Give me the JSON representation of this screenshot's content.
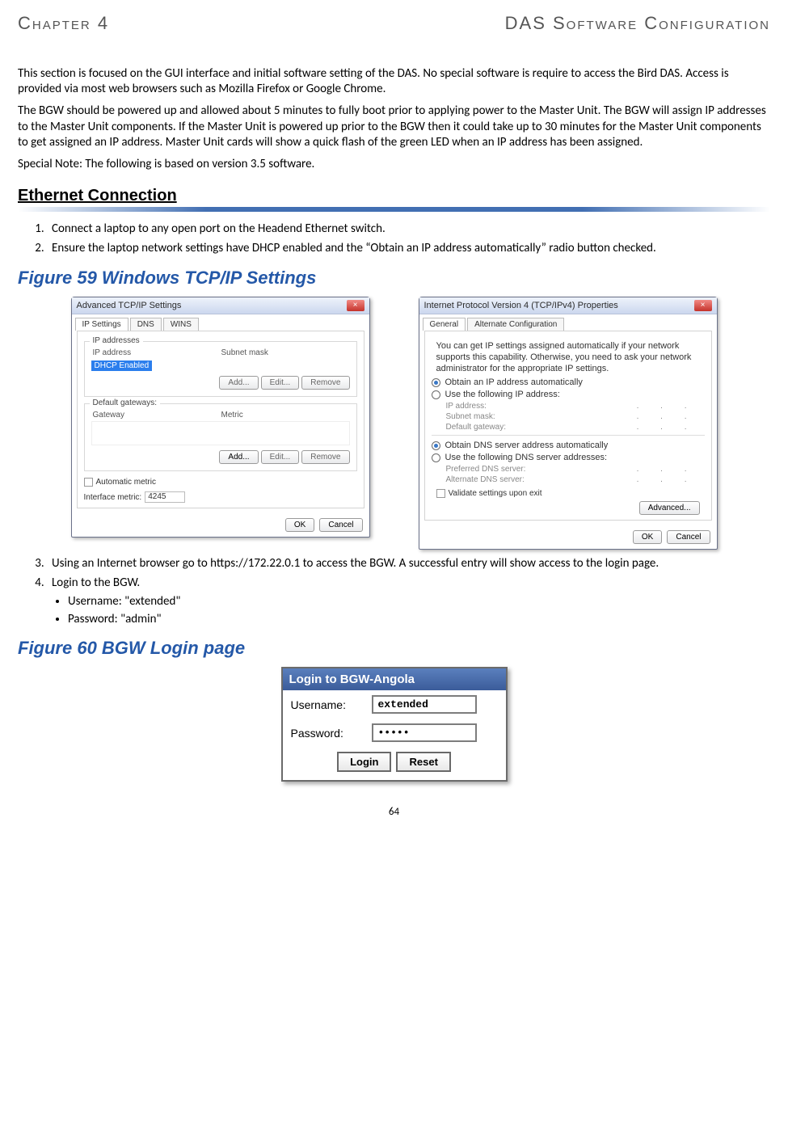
{
  "header": {
    "chapter": "Chapter 4",
    "title": "DAS Software Configuration"
  },
  "paras": {
    "p1": "This section is focused on the GUI interface and initial software setting of the DAS. No special software is require to access the Bird DAS. Access is provided via most web browsers such as Mozilla Firefox or Google Chrome.",
    "p2": "The BGW should be powered up and allowed about 5 minutes to fully boot prior to applying power to the Master Unit. The BGW will assign IP addresses to the Master Unit components. If the Master Unit is powered up prior to the BGW then it could take up to 30 minutes for the Master Unit components to get assigned an IP address. Master Unit cards will show a quick flash of the green LED when an IP address has been assigned.",
    "p3": "Special Note: The following is based on version 3.5 software."
  },
  "sections": {
    "ethernet": "Ethernet Connection"
  },
  "steps": {
    "s1": "Connect a laptop to any open port on the Headend Ethernet switch.",
    "s2": "Ensure the laptop network settings have DHCP enabled and the “Obtain an IP address automatically” radio button checked.",
    "s3": "Using an Internet browser go to https://172.22.0.1 to access the BGW. A successful entry will show access to the login page.",
    "s4": "Login to the BGW.",
    "b1": "Username: \"extended\"",
    "b2": "Password: \"admin\""
  },
  "figs": {
    "f59": "Figure 59    Windows TCP/IP Settings",
    "f60": "Figure 60    BGW Login page"
  },
  "dlg1": {
    "title": "Advanced TCP/IP Settings",
    "tabs": [
      "IP Settings",
      "DNS",
      "WINS"
    ],
    "grp1": "IP addresses",
    "cols1": [
      "IP address",
      "Subnet mask"
    ],
    "dhcp": "DHCP Enabled",
    "btns_disabled": [
      "Add...",
      "Edit...",
      "Remove"
    ],
    "grp2": "Default gateways:",
    "cols2": [
      "Gateway",
      "Metric"
    ],
    "btns_mixed": {
      "enabled": "Add...",
      "disabled": [
        "Edit...",
        "Remove"
      ]
    },
    "autometric": "Automatic metric",
    "ifmetric_label": "Interface metric:",
    "ifmetric_value": "4245",
    "ok": "OK",
    "cancel": "Cancel"
  },
  "dlg2": {
    "title": "Internet Protocol Version 4 (TCP/IPv4) Properties",
    "tabs": [
      "General",
      "Alternate Configuration"
    ],
    "intro": "You can get IP settings assigned automatically if your network supports this capability. Otherwise, you need to ask your network administrator for the appropriate IP settings.",
    "r1": "Obtain an IP address automatically",
    "r2": "Use the following IP address:",
    "ip": "IP address:",
    "mask": "Subnet mask:",
    "gw": "Default gateway:",
    "r3": "Obtain DNS server address automatically",
    "r4": "Use the following DNS server addresses:",
    "pdns": "Preferred DNS server:",
    "adns": "Alternate DNS server:",
    "validate": "Validate settings upon exit",
    "advanced": "Advanced...",
    "ok": "OK",
    "cancel": "Cancel"
  },
  "bgw": {
    "title": "Login to BGW-Angola",
    "user_label": "Username:",
    "user_value": "extended",
    "pass_label": "Password:",
    "pass_value": "•••••",
    "login": "Login",
    "reset": "Reset"
  },
  "page_number": "64"
}
